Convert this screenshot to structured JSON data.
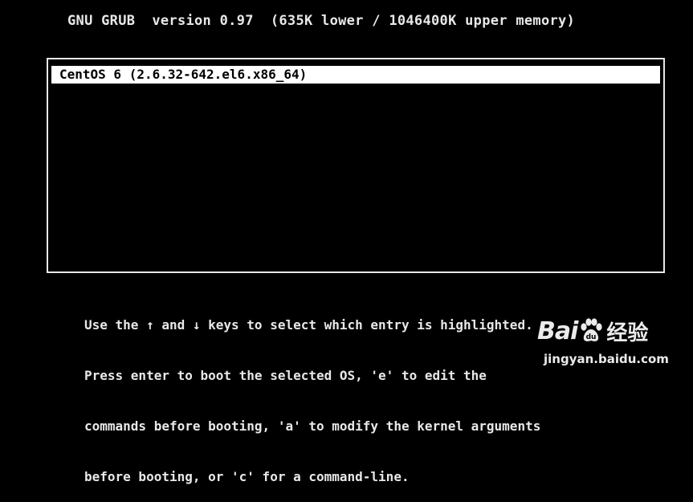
{
  "grub": {
    "header": "GNU GRUB  version 0.97  (635K lower / 1046400K upper memory)",
    "menu": {
      "entries": [
        {
          "label": "CentOS 6 (2.6.32-642.el6.x86_64)",
          "selected": true
        }
      ]
    },
    "help_lines": [
      "Use the ↑ and ↓ keys to select which entry is highlighted.",
      "Press enter to boot the selected OS, 'e' to edit the",
      "commands before booting, 'a' to modify the kernel arguments",
      "before booting, or 'c' for a command-line."
    ]
  },
  "watermark": {
    "brand_left": "Bai",
    "brand_right": "经验",
    "paw_icon": "baidu-paw-icon",
    "url": "jingyan.baidu.com"
  },
  "colors": {
    "background": "#000000",
    "text": "#e8e8e8",
    "highlight_bg": "#ffffff",
    "highlight_text": "#000000"
  }
}
